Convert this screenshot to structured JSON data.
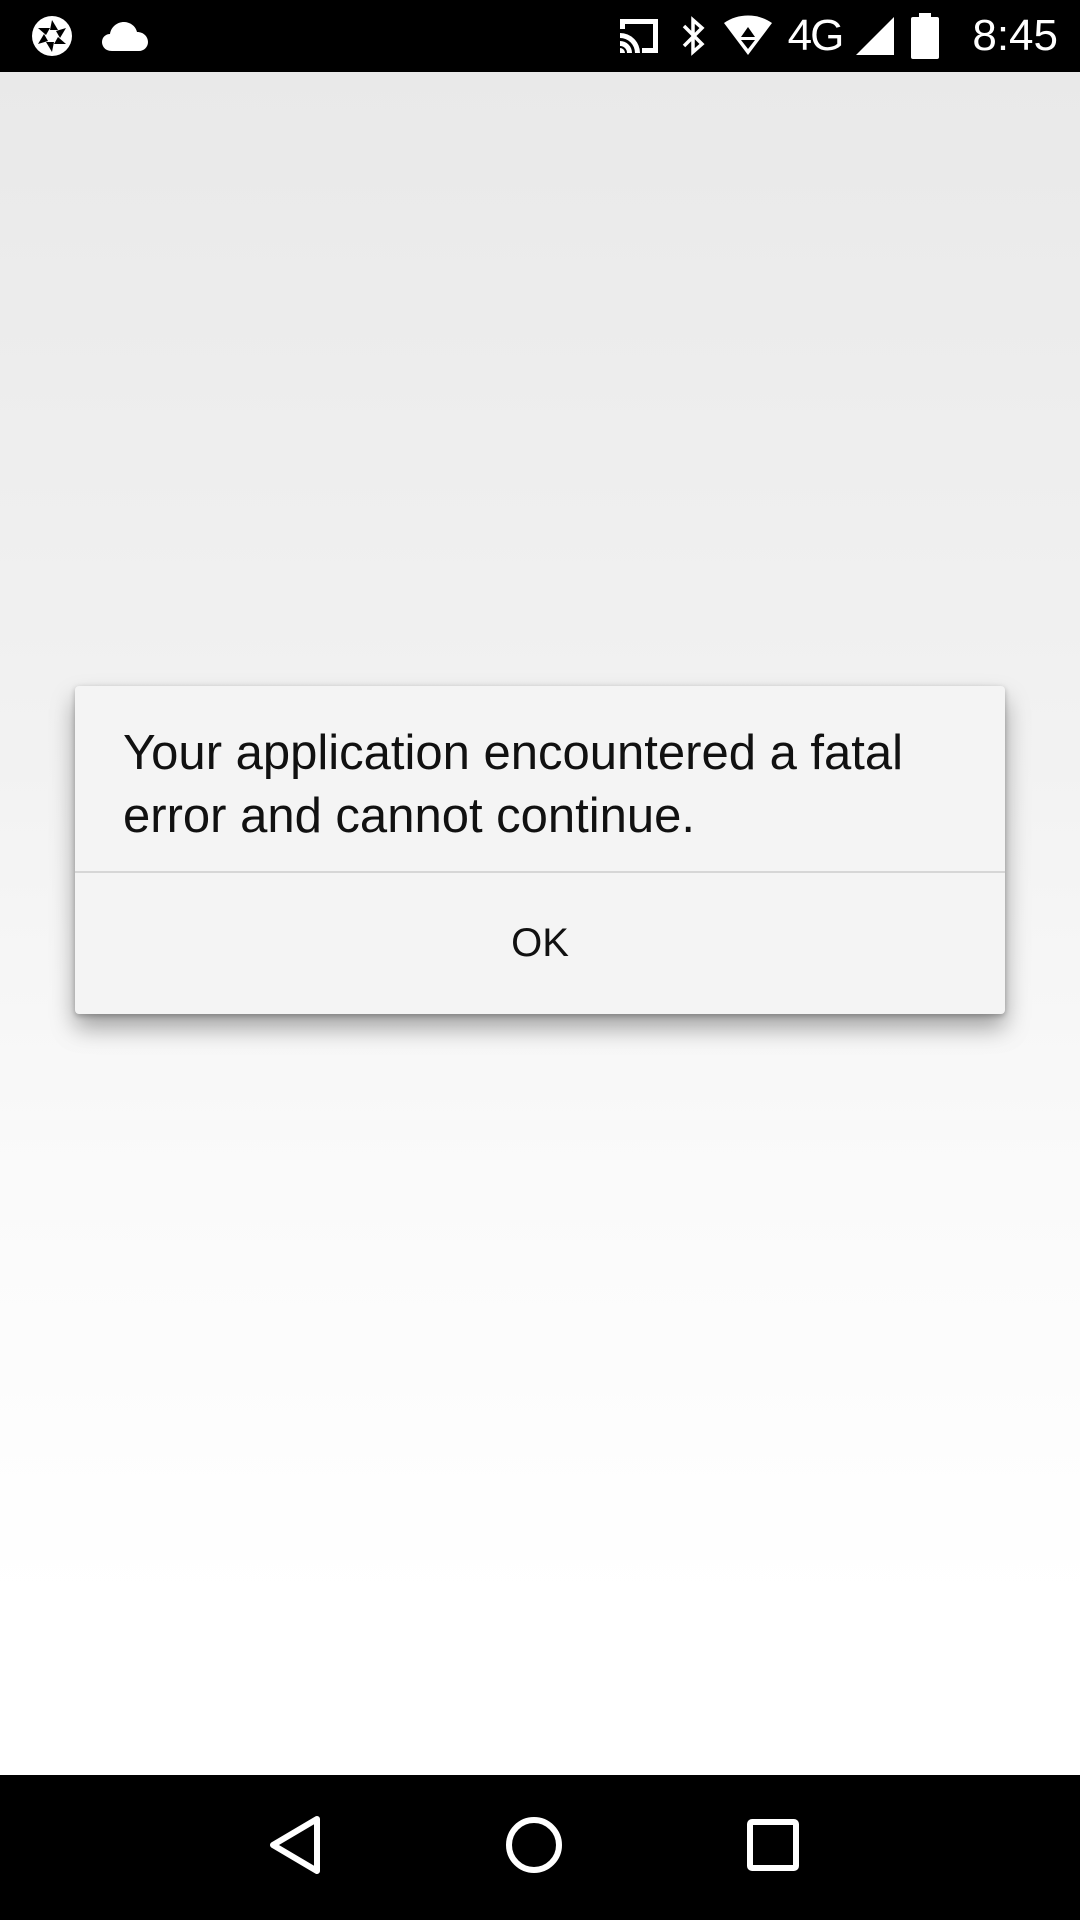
{
  "status_bar": {
    "left_icons": [
      "camera-aperture-icon",
      "cloud-icon"
    ],
    "right_icons": [
      "cast-icon",
      "bluetooth-icon",
      "wifi-icon",
      "signal-icon",
      "battery-icon"
    ],
    "network_type": "4G",
    "time": "8:45"
  },
  "dialog": {
    "message": "Your application encountered a fatal error and cannot continue.",
    "ok_label": "OK"
  },
  "nav_bar": {
    "icons": [
      "back-icon",
      "home-icon",
      "recents-icon"
    ]
  },
  "colors": {
    "status_bar_bg": "#000000",
    "nav_bar_bg": "#000000",
    "dialog_bg": "#f4f4f4",
    "text": "#111111"
  }
}
